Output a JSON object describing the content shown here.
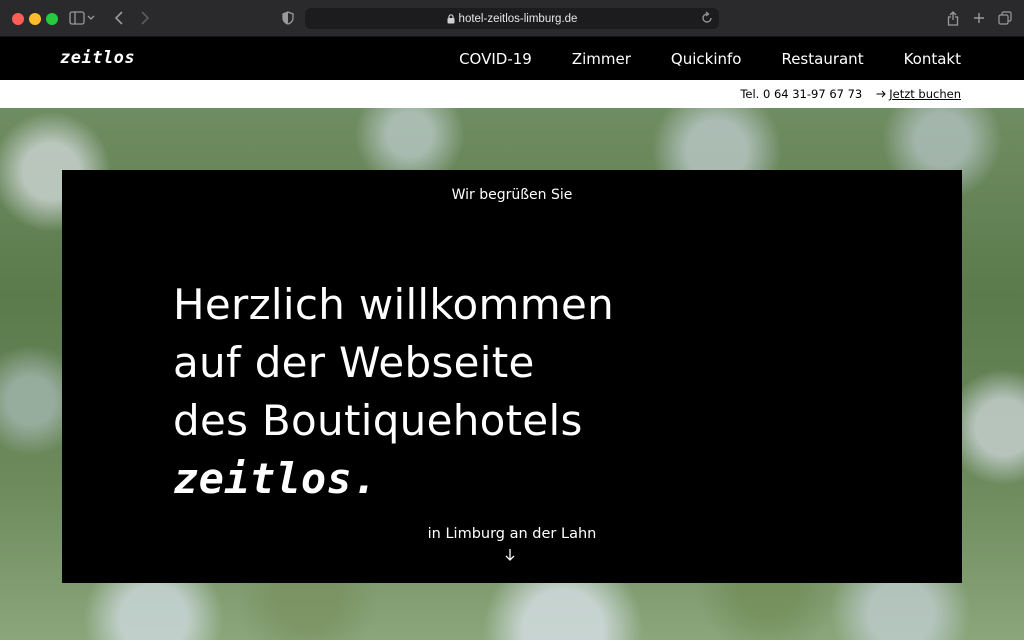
{
  "browser": {
    "url": "hotel-zeitlos-limburg.de"
  },
  "site": {
    "logo": "zeitlos",
    "nav": [
      "COVID-19",
      "Zimmer",
      "Quickinfo",
      "Restaurant",
      "Kontakt"
    ],
    "phone": "Tel. 0 64 31-97 67 73",
    "book_label": "Jetzt buchen"
  },
  "hero": {
    "kicker": "Wir begrüßen Sie",
    "headline_lines": [
      "Herzlich willkommen",
      "auf der Webseite",
      "des Boutiquehotels"
    ],
    "brand": "zeitlos.",
    "location": "in Limburg an der Lahn"
  },
  "icons": {
    "lock": "lock-icon",
    "arrow_right": "arrow-right-icon",
    "arrow_down": "arrow-down-icon"
  }
}
